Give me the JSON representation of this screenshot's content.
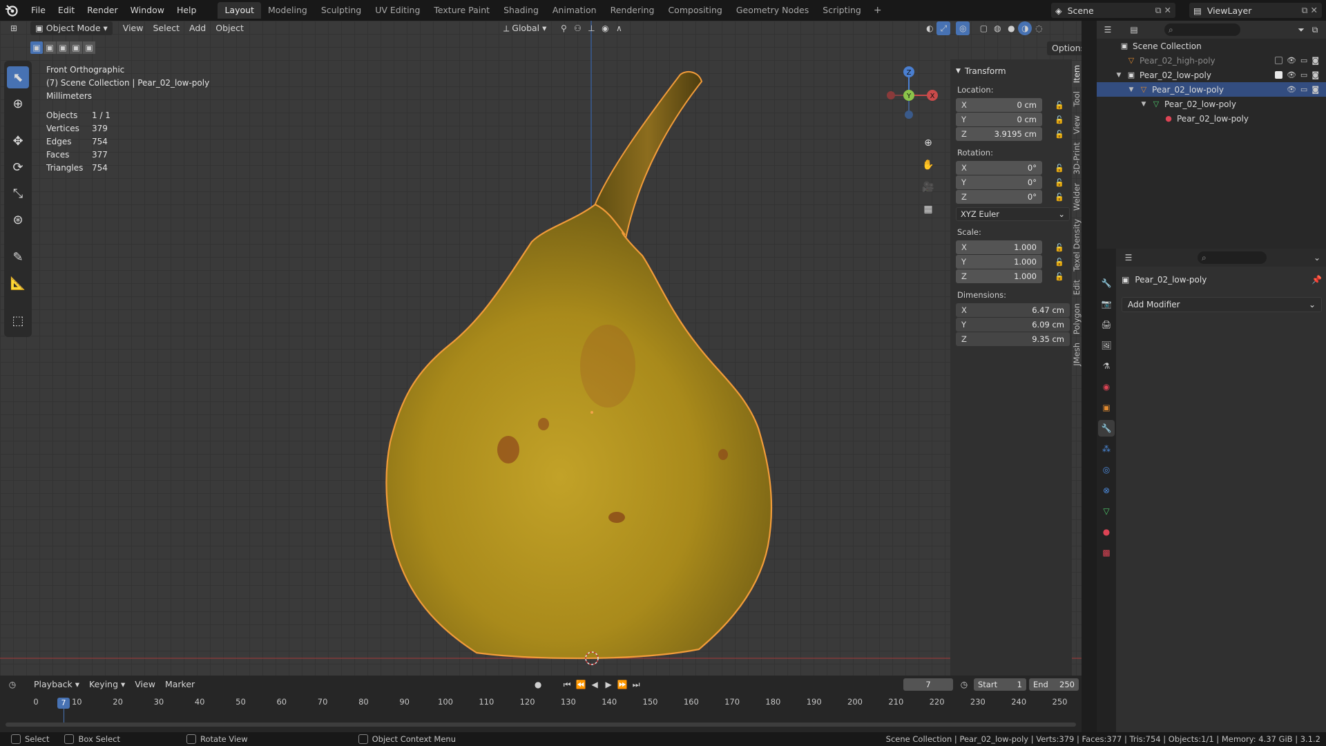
{
  "app": {
    "menus": [
      "File",
      "Edit",
      "Render",
      "Window",
      "Help"
    ]
  },
  "workspaces": [
    "Layout",
    "Modeling",
    "Sculpting",
    "UV Editing",
    "Texture Paint",
    "Shading",
    "Animation",
    "Rendering",
    "Compositing",
    "Geometry Nodes",
    "Scripting"
  ],
  "active_workspace": "Layout",
  "scene": {
    "name": "Scene",
    "view_layer": "ViewLayer"
  },
  "viewport_header": {
    "mode": "Object Mode",
    "menus": [
      "View",
      "Select",
      "Add",
      "Object"
    ],
    "orientation": "Global",
    "options": "Options"
  },
  "viewport_info": {
    "view_name": "Front Orthographic",
    "collection": "(7) Scene Collection | Pear_02_low-poly",
    "units": "Millimeters"
  },
  "stats": [
    {
      "label": "Objects",
      "value": "1 / 1"
    },
    {
      "label": "Vertices",
      "value": "379"
    },
    {
      "label": "Edges",
      "value": "754"
    },
    {
      "label": "Faces",
      "value": "377"
    },
    {
      "label": "Triangles",
      "value": "754"
    }
  ],
  "gizmo": {
    "z": "Z",
    "y": "Y",
    "x": "X"
  },
  "transform": {
    "title": "Transform",
    "location_label": "Location:",
    "location": [
      {
        "axis": "X",
        "value": "0 cm"
      },
      {
        "axis": "Y",
        "value": "0 cm"
      },
      {
        "axis": "Z",
        "value": "3.9195 cm"
      }
    ],
    "rotation_label": "Rotation:",
    "rotation": [
      {
        "axis": "X",
        "value": "0°"
      },
      {
        "axis": "Y",
        "value": "0°"
      },
      {
        "axis": "Z",
        "value": "0°"
      }
    ],
    "rotation_mode": "XYZ Euler",
    "scale_label": "Scale:",
    "scale": [
      {
        "axis": "X",
        "value": "1.000"
      },
      {
        "axis": "Y",
        "value": "1.000"
      },
      {
        "axis": "Z",
        "value": "1.000"
      }
    ],
    "dimensions_label": "Dimensions:",
    "dimensions": [
      {
        "axis": "X",
        "value": "6.47 cm"
      },
      {
        "axis": "Y",
        "value": "6.09 cm"
      },
      {
        "axis": "Z",
        "value": "9.35 cm"
      }
    ]
  },
  "side_tabs": [
    "Item",
    "Tool",
    "View",
    "3D-Print",
    "Welder",
    "Texel Density",
    "Edit",
    "Polygon",
    "JMesh"
  ],
  "outliner": {
    "root": "Scene Collection",
    "items": [
      {
        "name": "Pear_02_high-poly",
        "depth": 1,
        "dim": true,
        "selected": false,
        "icon": "mesh-object-icon",
        "caret": ""
      },
      {
        "name": "Pear_02_low-poly",
        "depth": 1,
        "dim": false,
        "selected": false,
        "icon": "collection-icon",
        "caret": "▼"
      },
      {
        "name": "Pear_02_low-poly",
        "depth": 2,
        "dim": false,
        "selected": true,
        "icon": "mesh-object-icon",
        "caret": "▼"
      },
      {
        "name": "Pear_02_low-poly",
        "depth": 3,
        "dim": false,
        "selected": false,
        "icon": "mesh-data-icon",
        "caret": "▼"
      },
      {
        "name": "Pear_02_low-poly",
        "depth": 4,
        "dim": false,
        "selected": false,
        "icon": "material-icon",
        "caret": ""
      }
    ]
  },
  "properties": {
    "object_name": "Pear_02_low-poly",
    "add_modifier": "Add Modifier"
  },
  "timeline": {
    "menus": [
      "Playback",
      "Keying",
      "View",
      "Marker"
    ],
    "current_frame": "7",
    "start_label": "Start",
    "start": "1",
    "end_label": "End",
    "end": "250",
    "ticks": [
      "0",
      "10",
      "20",
      "30",
      "40",
      "50",
      "60",
      "70",
      "80",
      "90",
      "100",
      "110",
      "120",
      "130",
      "140",
      "150",
      "160",
      "170",
      "180",
      "190",
      "200",
      "210",
      "220",
      "230",
      "240",
      "250"
    ],
    "playhead": "7"
  },
  "statusbar": {
    "items": [
      "Select",
      "Box Select",
      "Rotate View",
      "Object Context Menu"
    ],
    "right": "Scene Collection | Pear_02_low-poly | Verts:379 | Faces:377 | Tris:754 | Objects:1/1 | Memory: 4.37 GiB | 3.1.2"
  },
  "colors": {
    "accent": "#4772b3",
    "selection_outline": "#f29c3a",
    "pear_body": "#b89a23",
    "pear_shadow": "#6d5a14",
    "x_axis": "#c94a4a",
    "y_axis": "#8bc34a",
    "z_axis": "#4a7fd1"
  }
}
